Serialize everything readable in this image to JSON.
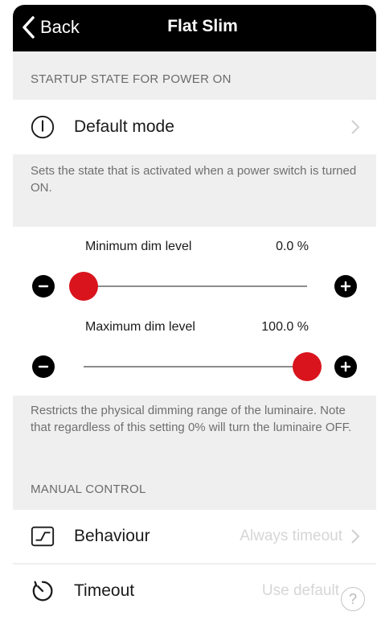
{
  "nav": {
    "back_label": "Back",
    "title": "Flat Slim"
  },
  "startup": {
    "section_title": "STARTUP STATE FOR POWER ON",
    "mode_label": "Default mode",
    "mode_icon": "power-icon",
    "description": "Sets the state that is activated when a power switch is turned ON."
  },
  "dim": {
    "min": {
      "label": "Minimum dim level",
      "value_text": "0.0 %",
      "level_percent": 0
    },
    "max": {
      "label": "Maximum dim level",
      "value_text": "100.0 %",
      "level_percent": 100
    },
    "description": "Restricts the physical dimming range of the luminaire. Note that regardless of this setting 0% will turn the luminaire OFF.",
    "accent_color": "#d9141d"
  },
  "manual": {
    "section_title": "MANUAL CONTROL",
    "behaviour": {
      "label": "Behaviour",
      "value": "Always timeout",
      "icon": "behaviour-graph-icon"
    },
    "timeout": {
      "label": "Timeout",
      "value": "Use default",
      "icon": "timer-icon"
    }
  },
  "help_icon": "question-mark-icon"
}
